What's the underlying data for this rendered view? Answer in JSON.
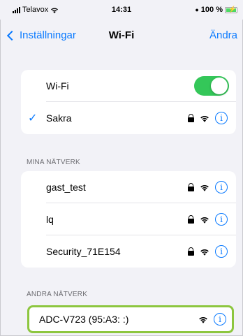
{
  "status_bar": {
    "carrier": "Telavox",
    "time": "14:31",
    "battery": "100 %"
  },
  "nav": {
    "back_label": "Inställningar",
    "title": "Wi-Fi",
    "edit_label": "Ändra"
  },
  "wifi_group": {
    "toggle_label": "Wi-Fi",
    "toggle_on": true,
    "connected_network": "Sakra"
  },
  "my_networks": {
    "header": "MINA NÄTVERK",
    "items": [
      {
        "name": "gast_test"
      },
      {
        "name": "lq"
      },
      {
        "name": "Security_71E154"
      }
    ]
  },
  "other_networks": {
    "header": "ANDRA NÄTVERK",
    "items": [
      {
        "name": "ADC-V723 (95:A3:  :)"
      }
    ]
  },
  "icons": {
    "lock": "lock-icon",
    "wifi": "wifi-icon",
    "info": "info-icon",
    "check": "checkmark-icon"
  },
  "colors": {
    "accent": "#0a7aff",
    "toggle_on": "#34c759",
    "highlight": "#8dc63f",
    "background": "#f2f2f7"
  }
}
